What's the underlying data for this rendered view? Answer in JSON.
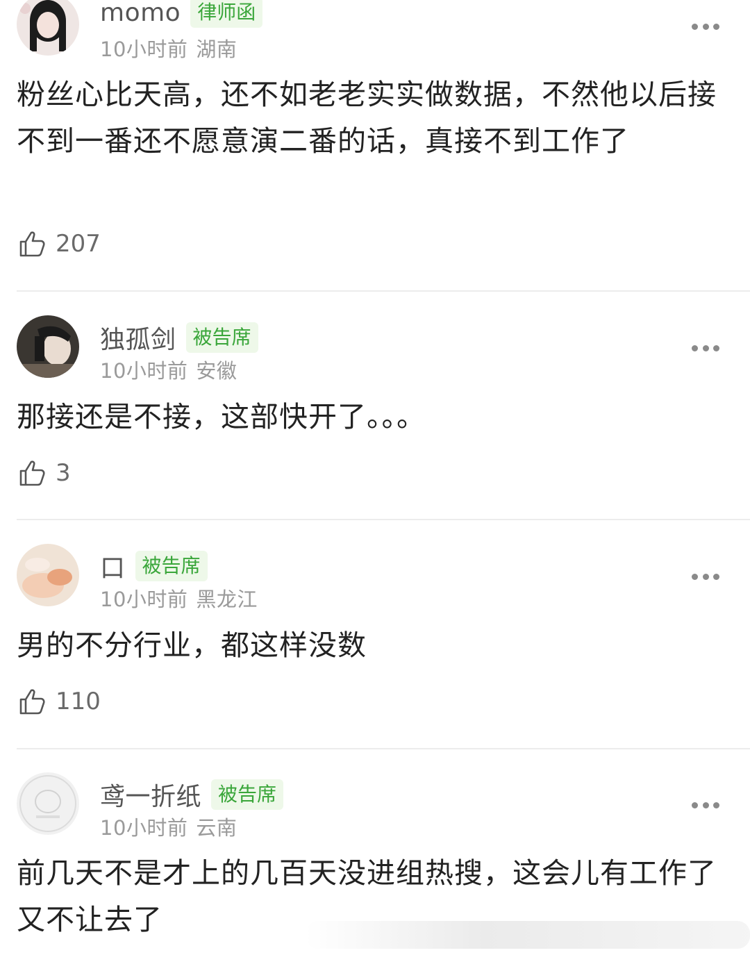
{
  "comments": [
    {
      "username": "momo",
      "tag": "律师函",
      "time": "10小时前",
      "location": "湖南",
      "text": "粉丝心比天高，还不如老老实实做数据，不然他以后接不到一番还不愿意演二番的话，真接不到工作了",
      "likes": "207"
    },
    {
      "username": "独孤剑",
      "tag": "被告席",
      "time": "10小时前",
      "location": "安徽",
      "text": "那接还是不接，这部快开了。。。",
      "likes": "3"
    },
    {
      "username": "口",
      "tag": "被告席",
      "time": "10小时前",
      "location": "黑龙江",
      "text": "男的不分行业，都这样没数",
      "likes": "110"
    },
    {
      "username": "鸢一折纸",
      "tag": "被告席",
      "time": "10小时前",
      "location": "云南",
      "text": "前几天不是才上的几百天没进组热搜，这会儿有工作了又不让去了"
    }
  ]
}
